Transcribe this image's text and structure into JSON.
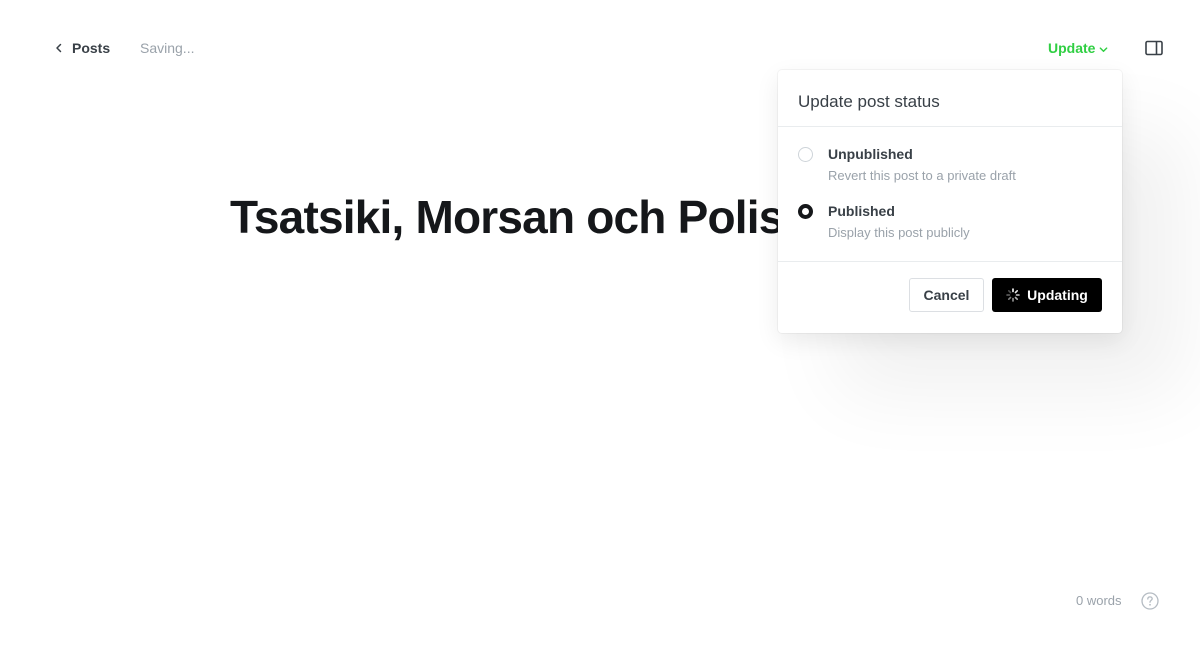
{
  "header": {
    "back_label": "Posts",
    "status_text": "Saving...",
    "update_label": "Update",
    "back_icon": "chevron-left-icon",
    "sidebar_icon": "sidebar-panel-icon"
  },
  "post": {
    "title": "Tsatsiki, Morsan och Polisen"
  },
  "popup": {
    "title": "Update post status",
    "options": [
      {
        "label": "Unpublished",
        "description": "Revert this post to a private draft",
        "selected": false
      },
      {
        "label": "Published",
        "description": "Display this post publicly",
        "selected": true
      }
    ],
    "cancel_label": "Cancel",
    "confirm_label": "Updating"
  },
  "footer": {
    "word_count": "0 words",
    "help_icon": "question-circle-icon"
  },
  "colors": {
    "accent_green": "#30cf43",
    "primary_button": "#000000",
    "muted_text": "#9aa2aa"
  }
}
